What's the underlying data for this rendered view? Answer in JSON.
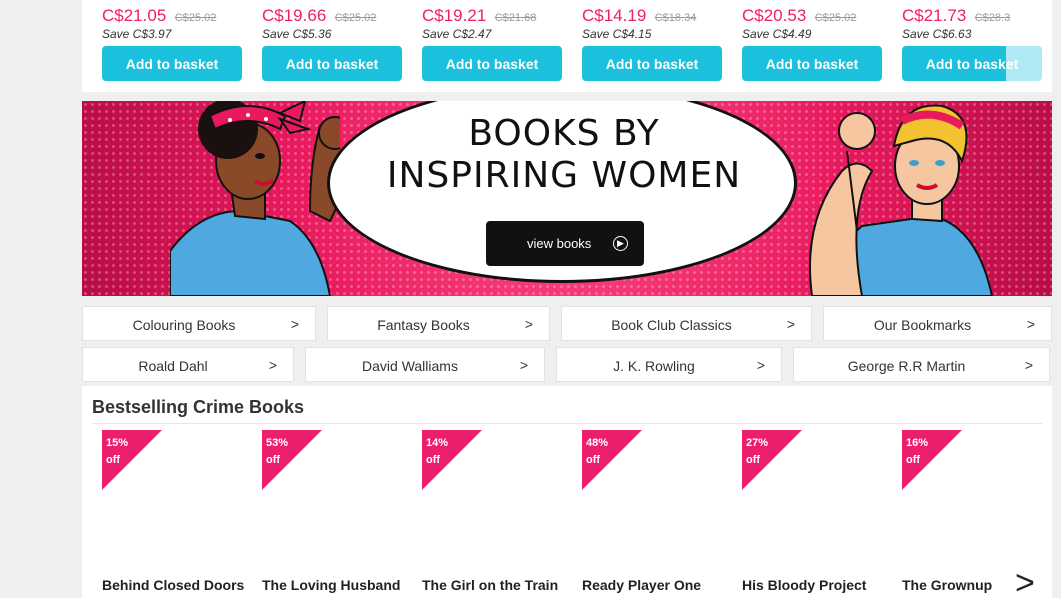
{
  "products": [
    {
      "price": "C$21.05",
      "rrp": "C$25.02",
      "save": "Save C$3.97",
      "button": "Add to basket"
    },
    {
      "price": "C$19.66",
      "rrp": "C$25.02",
      "save": "Save C$5.36",
      "button": "Add to basket"
    },
    {
      "price": "C$19.21",
      "rrp": "C$21.68",
      "save": "Save C$2.47",
      "button": "Add to basket"
    },
    {
      "price": "C$14.19",
      "rrp": "C$18.34",
      "save": "Save C$4.15",
      "button": "Add to basket"
    },
    {
      "price": "C$20.53",
      "rrp": "C$25.02",
      "save": "Save C$4.49",
      "button": "Add to basket"
    },
    {
      "price": "C$21.73",
      "rrp": "C$28.3",
      "save": "Save C$6.63",
      "button": "Add to basket"
    }
  ],
  "banner": {
    "headline_line1": "BOOKS BY",
    "headline_line2": "INSPIRING WOMEN",
    "button": "view books",
    "button_icon": "circle-chevron-right-icon"
  },
  "categories_row1": [
    {
      "label": "Colouring Books",
      "arrow": ">"
    },
    {
      "label": "Fantasy Books",
      "arrow": ">"
    },
    {
      "label": "Book Club Classics",
      "arrow": ">"
    },
    {
      "label": "Our Bookmarks",
      "arrow": ">"
    }
  ],
  "categories_row2": [
    {
      "label": "Roald Dahl",
      "arrow": ">"
    },
    {
      "label": "David Walliams",
      "arrow": ">"
    },
    {
      "label": "J. K. Rowling",
      "arrow": ">"
    },
    {
      "label": "George R.R Martin",
      "arrow": ">"
    }
  ],
  "bestsellers": {
    "title": "Bestselling Crime Books",
    "next_arrow": ">",
    "books": [
      {
        "discount": "15%\noff",
        "title": "Behind Closed Doors"
      },
      {
        "discount": "53%\noff",
        "title": "The Loving Husband"
      },
      {
        "discount": "14%\noff",
        "title": "The Girl on the Train"
      },
      {
        "discount": "48%\noff",
        "title": "Ready Player One"
      },
      {
        "discount": "27%\noff",
        "title": "His Bloody Project"
      },
      {
        "discount": "16%\noff",
        "title": "The Grownup"
      }
    ]
  },
  "colors": {
    "accent_pink": "#ec1e6e",
    "button_cyan": "#1ac0dc",
    "banner_pink": "#e8195d"
  }
}
